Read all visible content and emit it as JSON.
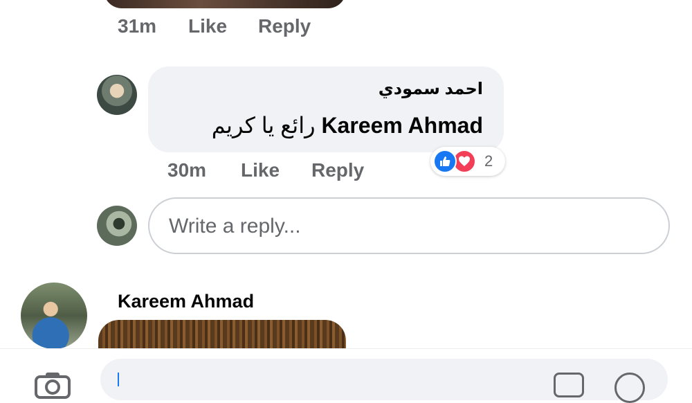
{
  "top_comment": {
    "time": "31m",
    "like_label": "Like",
    "reply_label": "Reply"
  },
  "reply": {
    "author": "احمد سمودي",
    "mention": "Kareem Ahmad",
    "text": "رائع يا كريم",
    "time": "30m",
    "like_label": "Like",
    "reply_label": "Reply",
    "reactions": {
      "types": [
        "like",
        "love"
      ],
      "count": "2"
    }
  },
  "reply_box": {
    "placeholder": "Write a reply..."
  },
  "next_comment": {
    "author": "Kareem Ahmad"
  },
  "colors": {
    "like_blue": "#1877f2",
    "love_red": "#f33e58",
    "meta_gray": "#65676b",
    "bubble_bg": "#f0f2f5"
  },
  "icons": {
    "camera": "camera-icon",
    "gif": "gif-icon",
    "emoji": "emoji-icon"
  }
}
